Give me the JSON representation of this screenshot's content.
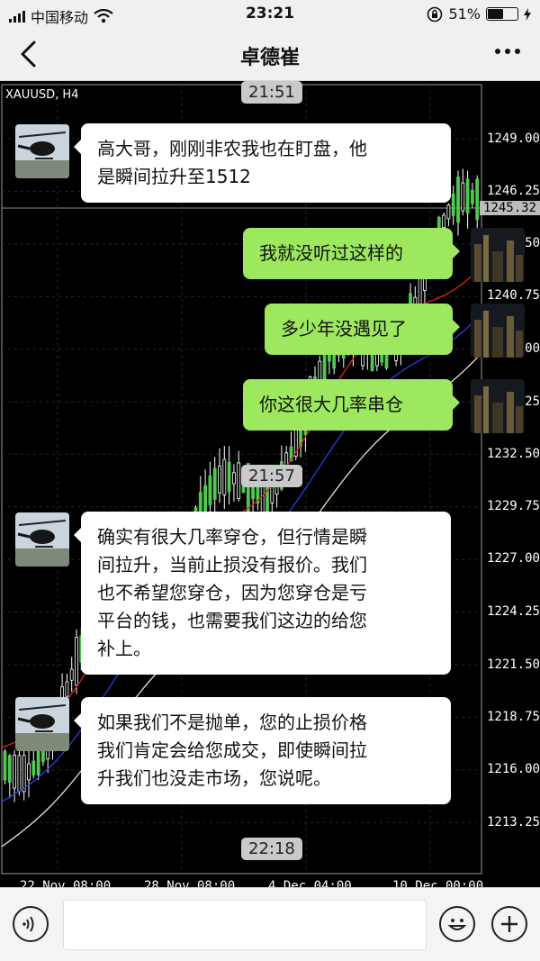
{
  "status_bar": {
    "carrier": "中国移动",
    "time": "23:21",
    "battery": "51%"
  },
  "nav": {
    "title": "卓德崔"
  },
  "chart": {
    "symbol": "XAUUSD, H4",
    "current_price": "1245.32",
    "price_labels": [
      "1249.00",
      "1246.25",
      "50",
      "1240.75",
      "00",
      "25",
      "1232.50",
      "1229.75",
      "1227.00",
      "1224.25",
      "1221.50",
      "1218.75",
      "1216.00",
      "1213.25"
    ],
    "date_labels": [
      "22 Nov 08:00",
      "28 Nov 08:00",
      "4 Dec 04:00",
      "10 Dec 00:00"
    ]
  },
  "chat": {
    "timestamps": [
      "21:51",
      "21:57",
      "22:18"
    ],
    "messages": [
      {
        "side": "left",
        "text_lines": [
          "高大哥，刚刚非农我也在盯盘，他",
          "是瞬间拉升至1512"
        ]
      },
      {
        "side": "right",
        "text_lines": [
          "我就没听过这样的"
        ]
      },
      {
        "side": "right",
        "text_lines": [
          "多少年没遇见了"
        ]
      },
      {
        "side": "right",
        "text_lines": [
          "你这很大几率串仓"
        ]
      },
      {
        "side": "left",
        "text_lines": [
          "确实有很大几率穿仓，但行情是瞬",
          "间拉升，当前止损没有报价。我们",
          "也不希望您穿仓，因为您穿仓是亏",
          "平台的钱，也需要我们这边的给您",
          "补上。"
        ]
      },
      {
        "side": "left",
        "text_lines": [
          "如果我们不是抛单，您的止损价格",
          "我们肯定会给您成交，即使瞬间拉",
          "升我们也没走市场，您说呢。"
        ]
      }
    ]
  },
  "input": {
    "placeholder": ""
  }
}
